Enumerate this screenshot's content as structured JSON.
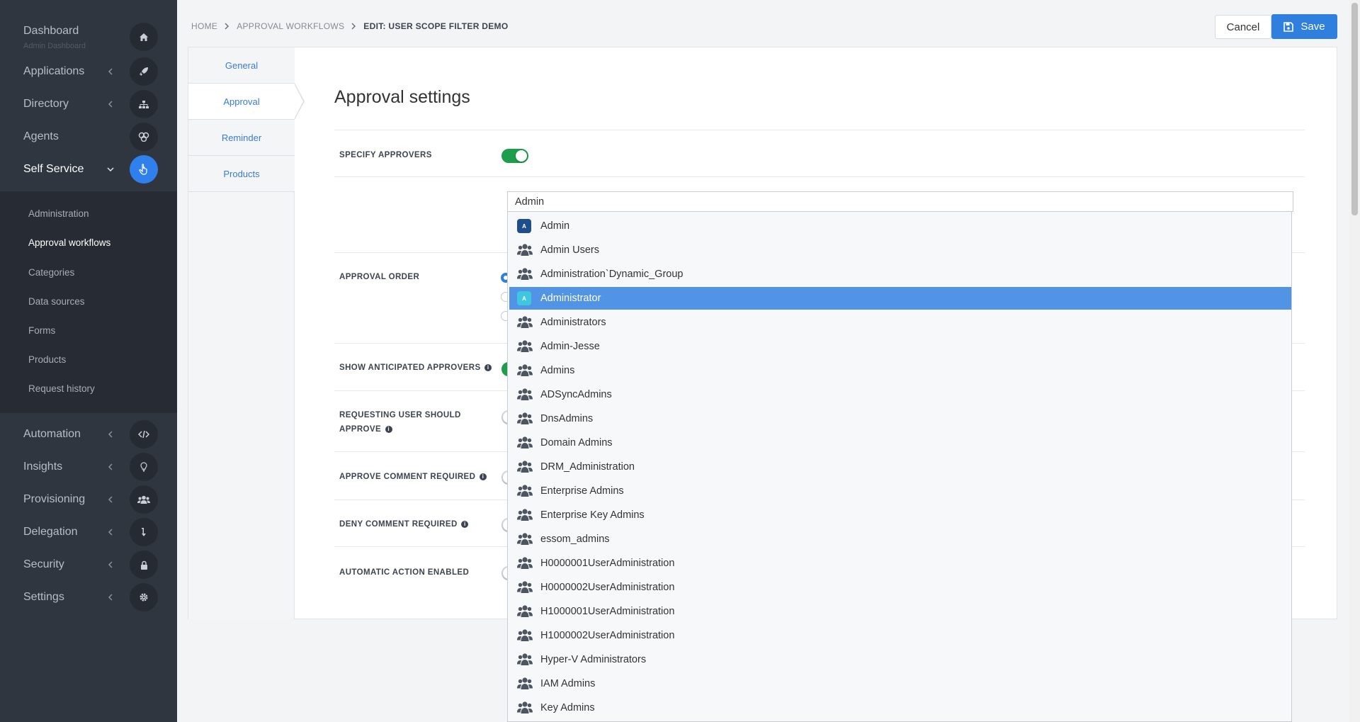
{
  "sidebar": {
    "items": [
      {
        "label": "Dashboard",
        "sub": "Admin Dashboard",
        "icon": "home-icon"
      },
      {
        "label": "Applications",
        "icon": "rocket-icon"
      },
      {
        "label": "Directory",
        "icon": "sitemap-icon"
      },
      {
        "label": "Agents",
        "icon": "agents-icon"
      },
      {
        "label": "Self Service",
        "icon": "hand-pointer-icon"
      },
      {
        "label": "Automation",
        "icon": "code-icon"
      },
      {
        "label": "Insights",
        "icon": "lightbulb-icon"
      },
      {
        "label": "Provisioning",
        "icon": "users-icon"
      },
      {
        "label": "Delegation",
        "icon": "delegation-icon"
      },
      {
        "label": "Security",
        "icon": "lock-icon"
      },
      {
        "label": "Settings",
        "icon": "gear-icon"
      }
    ],
    "submenu": [
      "Administration",
      "Approval workflows",
      "Categories",
      "Data sources",
      "Forms",
      "Products",
      "Request history"
    ]
  },
  "breadcrumb": [
    "HOME",
    "APPROVAL WORKFLOWS",
    "EDIT: USER SCOPE FILTER DEMO"
  ],
  "toolbar": {
    "cancel_label": "Cancel",
    "save_label": "Save"
  },
  "tabs": [
    "General",
    "Approval",
    "Reminder",
    "Products"
  ],
  "section_title": "Approval settings",
  "fields": {
    "specify_approvers": "SPECIFY APPROVERS",
    "approval_order": "APPROVAL ORDER",
    "show_anticipated": "SHOW ANTICIPATED APPROVERS",
    "requesting_user_1": "REQUESTING USER SHOULD",
    "requesting_user_2": "APPROVE",
    "approve_comment": "APPROVE COMMENT REQUIRED",
    "deny_comment": "DENY COMMENT REQUIRED",
    "automatic_action": "AUTOMATIC ACTION ENABLED"
  },
  "search": {
    "value": "Admin"
  },
  "dropdown": {
    "selected": "Administrator",
    "items": [
      {
        "label": "Admin",
        "icon": "user-badge-icon"
      },
      {
        "label": "Admin Users",
        "icon": "group-icon"
      },
      {
        "label": "Administration`Dynamic_Group",
        "icon": "group-icon"
      },
      {
        "label": "Administrator",
        "icon": "user-badge-icon"
      },
      {
        "label": "Administrators",
        "icon": "group-icon"
      },
      {
        "label": "Admin-Jesse",
        "icon": "group-icon"
      },
      {
        "label": "Admins",
        "icon": "group-icon"
      },
      {
        "label": "ADSyncAdmins",
        "icon": "group-icon"
      },
      {
        "label": "DnsAdmins",
        "icon": "group-icon"
      },
      {
        "label": "Domain Admins",
        "icon": "group-icon"
      },
      {
        "label": "DRM_Administration",
        "icon": "group-icon"
      },
      {
        "label": "Enterprise Admins",
        "icon": "group-icon"
      },
      {
        "label": "Enterprise Key Admins",
        "icon": "group-icon"
      },
      {
        "label": "essom_admins",
        "icon": "group-icon"
      },
      {
        "label": "H0000001UserAdministration",
        "icon": "group-icon"
      },
      {
        "label": "H0000002UserAdministration",
        "icon": "group-icon"
      },
      {
        "label": "H1000001UserAdministration",
        "icon": "group-icon"
      },
      {
        "label": "H1000002UserAdministration",
        "icon": "group-icon"
      },
      {
        "label": "Hyper-V Administrators",
        "icon": "group-icon"
      },
      {
        "label": "IAM Admins",
        "icon": "group-icon"
      },
      {
        "label": "Key Admins",
        "icon": "group-icon"
      }
    ]
  },
  "colors": {
    "accent": "#2f7fdf",
    "selected": "#5193e5",
    "toggle_on": "#1e9e4a",
    "sidebar": "#2f3640"
  }
}
